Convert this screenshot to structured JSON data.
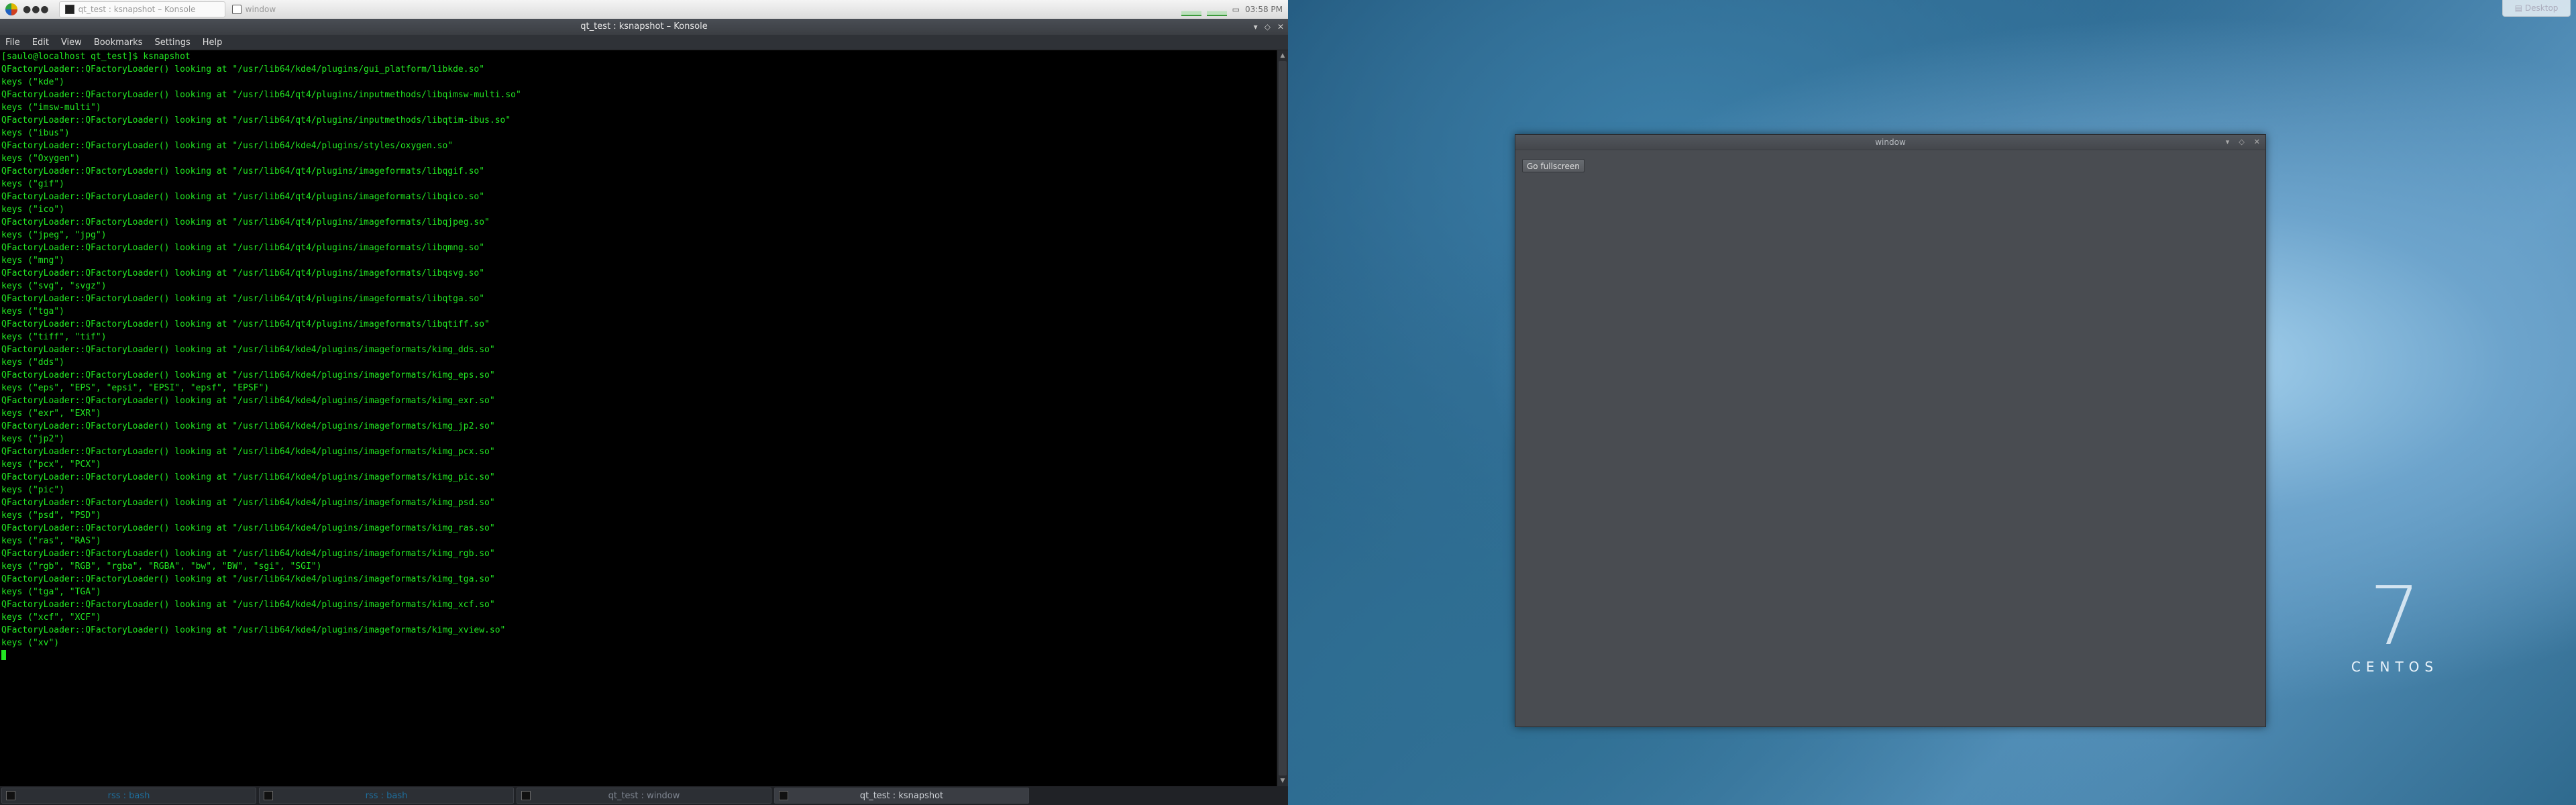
{
  "top_panel": {
    "tasks": [
      {
        "label": "qt_test : ksnapshot – Konsole"
      },
      {
        "label": "window"
      }
    ],
    "clock": "03:58 PM"
  },
  "konsole": {
    "title": "qt_test : ksnapshot – Konsole",
    "menu": [
      "File",
      "Edit",
      "View",
      "Bookmarks",
      "Settings",
      "Help"
    ],
    "lines": [
      "[saulo@localhost qt_test]$ ksnapshot",
      "QFactoryLoader::QFactoryLoader() looking at \"/usr/lib64/kde4/plugins/gui_platform/libkde.so\"",
      "keys (\"kde\")",
      "QFactoryLoader::QFactoryLoader() looking at \"/usr/lib64/qt4/plugins/inputmethods/libqimsw-multi.so\"",
      "keys (\"imsw-multi\")",
      "QFactoryLoader::QFactoryLoader() looking at \"/usr/lib64/qt4/plugins/inputmethods/libqtim-ibus.so\"",
      "keys (\"ibus\")",
      "QFactoryLoader::QFactoryLoader() looking at \"/usr/lib64/kde4/plugins/styles/oxygen.so\"",
      "keys (\"Oxygen\")",
      "QFactoryLoader::QFactoryLoader() looking at \"/usr/lib64/qt4/plugins/imageformats/libqgif.so\"",
      "keys (\"gif\")",
      "QFactoryLoader::QFactoryLoader() looking at \"/usr/lib64/qt4/plugins/imageformats/libqico.so\"",
      "keys (\"ico\")",
      "QFactoryLoader::QFactoryLoader() looking at \"/usr/lib64/qt4/plugins/imageformats/libqjpeg.so\"",
      "keys (\"jpeg\", \"jpg\")",
      "QFactoryLoader::QFactoryLoader() looking at \"/usr/lib64/qt4/plugins/imageformats/libqmng.so\"",
      "keys (\"mng\")",
      "QFactoryLoader::QFactoryLoader() looking at \"/usr/lib64/qt4/plugins/imageformats/libqsvg.so\"",
      "keys (\"svg\", \"svgz\")",
      "QFactoryLoader::QFactoryLoader() looking at \"/usr/lib64/qt4/plugins/imageformats/libqtga.so\"",
      "keys (\"tga\")",
      "QFactoryLoader::QFactoryLoader() looking at \"/usr/lib64/qt4/plugins/imageformats/libqtiff.so\"",
      "keys (\"tiff\", \"tif\")",
      "QFactoryLoader::QFactoryLoader() looking at \"/usr/lib64/kde4/plugins/imageformats/kimg_dds.so\"",
      "keys (\"dds\")",
      "QFactoryLoader::QFactoryLoader() looking at \"/usr/lib64/kde4/plugins/imageformats/kimg_eps.so\"",
      "keys (\"eps\", \"EPS\", \"epsi\", \"EPSI\", \"epsf\", \"EPSF\")",
      "QFactoryLoader::QFactoryLoader() looking at \"/usr/lib64/kde4/plugins/imageformats/kimg_exr.so\"",
      "keys (\"exr\", \"EXR\")",
      "QFactoryLoader::QFactoryLoader() looking at \"/usr/lib64/kde4/plugins/imageformats/kimg_jp2.so\"",
      "keys (\"jp2\")",
      "QFactoryLoader::QFactoryLoader() looking at \"/usr/lib64/kde4/plugins/imageformats/kimg_pcx.so\"",
      "keys (\"pcx\", \"PCX\")",
      "QFactoryLoader::QFactoryLoader() looking at \"/usr/lib64/kde4/plugins/imageformats/kimg_pic.so\"",
      "keys (\"pic\")",
      "QFactoryLoader::QFactoryLoader() looking at \"/usr/lib64/kde4/plugins/imageformats/kimg_psd.so\"",
      "keys (\"psd\", \"PSD\")",
      "QFactoryLoader::QFactoryLoader() looking at \"/usr/lib64/kde4/plugins/imageformats/kimg_ras.so\"",
      "keys (\"ras\", \"RAS\")",
      "QFactoryLoader::QFactoryLoader() looking at \"/usr/lib64/kde4/plugins/imageformats/kimg_rgb.so\"",
      "keys (\"rgb\", \"RGB\", \"rgba\", \"RGBA\", \"bw\", \"BW\", \"sgi\", \"SGI\")",
      "QFactoryLoader::QFactoryLoader() looking at \"/usr/lib64/kde4/plugins/imageformats/kimg_tga.so\"",
      "keys (\"tga\", \"TGA\")",
      "QFactoryLoader::QFactoryLoader() looking at \"/usr/lib64/kde4/plugins/imageformats/kimg_xcf.so\"",
      "keys (\"xcf\", \"XCF\")",
      "QFactoryLoader::QFactoryLoader() looking at \"/usr/lib64/kde4/plugins/imageformats/kimg_xview.so\"",
      "keys (\"xv\")"
    ]
  },
  "bottom_taskbar": {
    "items": [
      {
        "label": "rss : bash"
      },
      {
        "label": "rss : bash"
      },
      {
        "label": "qt_test : window"
      },
      {
        "label": "qt_test : ksnapshot"
      }
    ]
  },
  "desktop": {
    "button_label": "Desktop",
    "logo_number": "7",
    "logo_text": "CENTOS"
  },
  "qt_window": {
    "title": "window",
    "button_label": "Go fullscreen"
  },
  "colors": {
    "terminal_text": "#22e622",
    "terminal_bg": "#000000",
    "window_bg": "#494c51"
  }
}
